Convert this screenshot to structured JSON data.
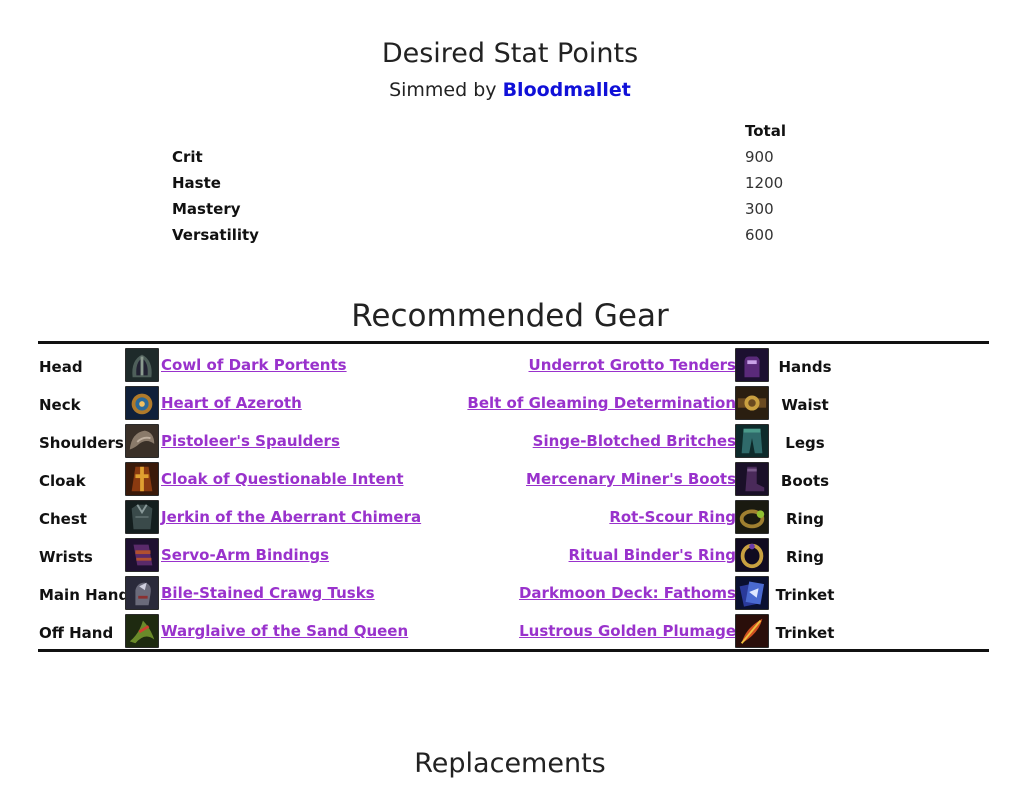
{
  "header": {
    "title": "Desired Stat Points",
    "simmed_prefix": "Simmed by ",
    "simmed_link": "Bloodmallet"
  },
  "stats": {
    "column_header": "Total",
    "rows": [
      {
        "name": "Crit",
        "value": "900"
      },
      {
        "name": "Haste",
        "value": "1200"
      },
      {
        "name": "Mastery",
        "value": "300"
      },
      {
        "name": "Versatility",
        "value": "600"
      }
    ]
  },
  "gear": {
    "title": "Recommended Gear",
    "left": [
      {
        "slot": "Head",
        "item": "Cowl of Dark Portents",
        "icon": "helm-icon"
      },
      {
        "slot": "Neck",
        "item": "Heart of Azeroth",
        "icon": "amulet-icon"
      },
      {
        "slot": "Shoulders",
        "item": "Pistoleer's Spaulders",
        "icon": "shoulder-icon"
      },
      {
        "slot": "Cloak",
        "item": "Cloak of Questionable Intent",
        "icon": "cloak-icon"
      },
      {
        "slot": "Chest",
        "item": "Jerkin of the Aberrant Chimera",
        "icon": "chest-icon"
      },
      {
        "slot": "Wrists",
        "item": "Servo-Arm Bindings",
        "icon": "bracer-icon"
      },
      {
        "slot": "Main Hand",
        "item": "Bile-Stained Crawg Tusks",
        "icon": "fist-weapon-icon"
      },
      {
        "slot": "Off Hand",
        "item": "Warglaive of the Sand Queen",
        "icon": "glaive-icon"
      }
    ],
    "right": [
      {
        "slot": "Hands",
        "item": "Underrot Grotto Tenders",
        "icon": "gloves-icon"
      },
      {
        "slot": "Waist",
        "item": "Belt of Gleaming Determination",
        "icon": "belt-icon"
      },
      {
        "slot": "Legs",
        "item": "Singe-Blotched Britches",
        "icon": "pants-icon"
      },
      {
        "slot": "Boots",
        "item": "Mercenary Miner's Boots",
        "icon": "boots-icon"
      },
      {
        "slot": "Ring",
        "item": "Rot-Scour Ring",
        "icon": "ring-icon"
      },
      {
        "slot": "Ring",
        "item": "Ritual Binder's Ring",
        "icon": "ring-icon"
      },
      {
        "slot": "Trinket",
        "item": "Darkmoon Deck: Fathoms",
        "icon": "card-deck-icon"
      },
      {
        "slot": "Trinket",
        "item": "Lustrous Golden Plumage",
        "icon": "feather-icon"
      }
    ]
  },
  "replacements": {
    "title": "Replacements"
  },
  "colors": {
    "item_link": "#9932cc",
    "author_link": "#1010d8",
    "rule": "#111111"
  }
}
